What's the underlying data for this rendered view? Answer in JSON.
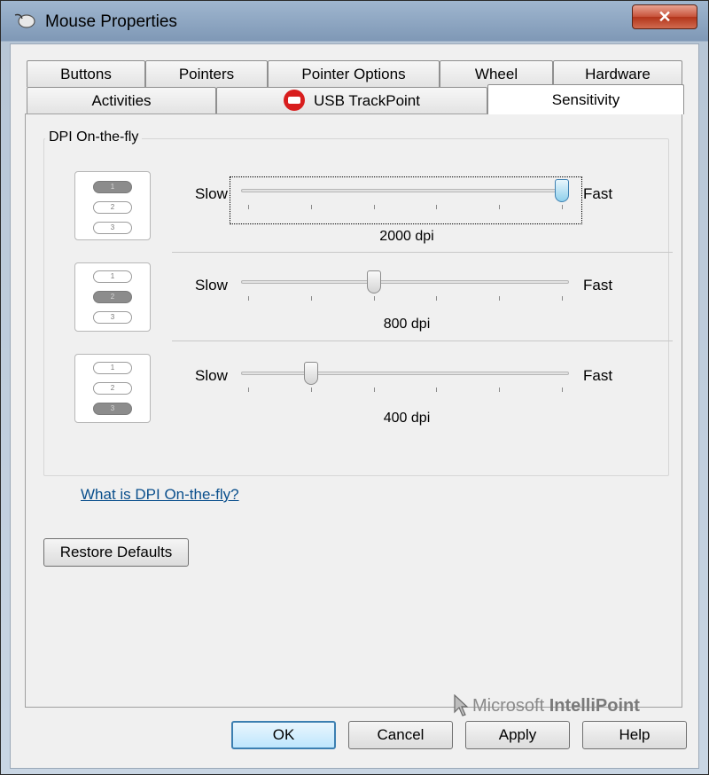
{
  "window": {
    "title": "Mouse Properties",
    "close_glyph": "✕"
  },
  "tabs": {
    "row1": [
      "Buttons",
      "Pointers",
      "Pointer Options",
      "Wheel",
      "Hardware"
    ],
    "row2": [
      "Activities",
      "USB TrackPoint",
      "Sensitivity"
    ],
    "active": "Sensitivity"
  },
  "dpi_group": {
    "label": "DPI On-the-fly",
    "slow_label": "Slow",
    "fast_label": "Fast",
    "settings": [
      {
        "slot": "1",
        "value_text": "2000 dpi",
        "level": 1.0,
        "selected": true
      },
      {
        "slot": "2",
        "value_text": "800 dpi",
        "level": 0.4,
        "selected": false
      },
      {
        "slot": "3",
        "value_text": "400 dpi",
        "level": 0.2,
        "selected": false
      }
    ],
    "icon_slots": [
      "1",
      "2",
      "3"
    ],
    "help_link": "What is DPI On-the-fly?"
  },
  "restore_defaults": "Restore Defaults",
  "brand": {
    "prefix": "Microsoft ",
    "name": "IntelliPoint"
  },
  "footer": {
    "ok": "OK",
    "cancel": "Cancel",
    "apply": "Apply",
    "help": "Help"
  },
  "colors": {
    "title_bar": "#7f98b6",
    "close_button": "#c7523a",
    "link": "#0a4f8c",
    "slider_focus": "#8fd0ec"
  }
}
